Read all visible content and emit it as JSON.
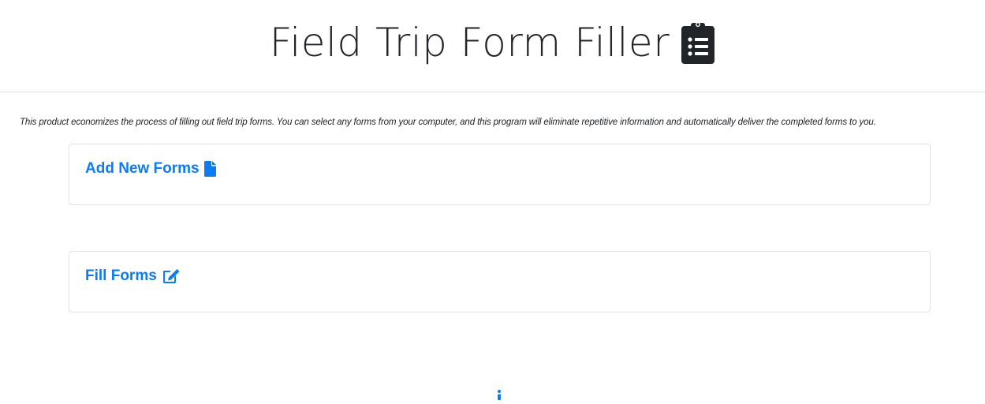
{
  "header": {
    "title": "Field Trip Form Filler",
    "icon": "clipboard-list-icon"
  },
  "description": "This product economizes the process of filling out field trip forms. You can select any forms from your computer, and this program will eliminate repetitive information and automatically deliver the completed forms to you.",
  "cards": [
    {
      "label": "Add New Forms",
      "icon": "file-icon"
    },
    {
      "label": "Fill Forms",
      "icon": "edit-icon"
    }
  ],
  "footer": {
    "icon": "info-icon"
  },
  "colors": {
    "link": "#0d7cf2",
    "text": "#212529",
    "border": "#dee2e6"
  }
}
